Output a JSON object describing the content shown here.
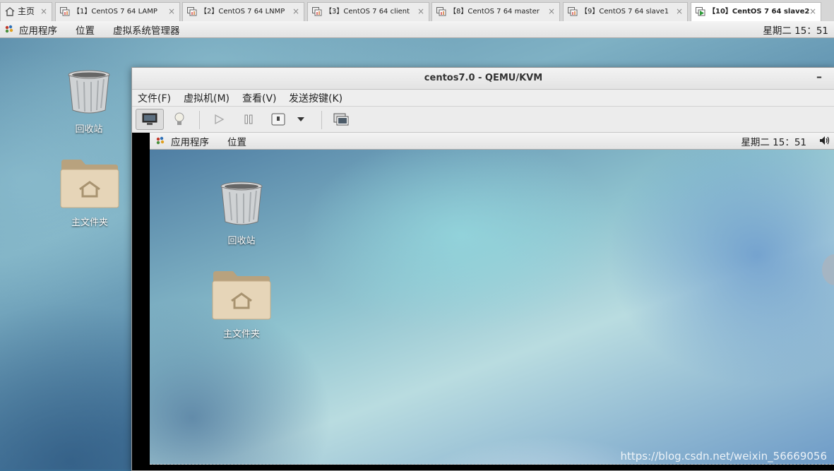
{
  "tabs": [
    {
      "label": "主页",
      "icon": "home-icon",
      "active": false
    },
    {
      "label": "【1】CentOS 7 64  LAMP",
      "icon": "vm-icon",
      "active": false
    },
    {
      "label": "【2】CentOS 7 64 LNMP",
      "icon": "vm-icon",
      "active": false
    },
    {
      "label": "【3】CentOS 7 64 client",
      "icon": "vm-icon",
      "active": false
    },
    {
      "label": "【8】CentOS 7 64 master",
      "icon": "vm-icon",
      "active": false
    },
    {
      "label": "【9】CentOS 7 64 slave1",
      "icon": "vm-icon",
      "active": false
    },
    {
      "label": "【10】CentOS 7 64 slave2",
      "icon": "vm-running-icon",
      "active": true
    }
  ],
  "tab_close_glyph": "×",
  "host_panel": {
    "menus": [
      "应用程序",
      "位置",
      "虚拟系统管理器"
    ],
    "clock": "星期二 15：51"
  },
  "host_desktop": {
    "icons": [
      {
        "label": "回收站",
        "icon": "trash-icon"
      },
      {
        "label": "主文件夹",
        "icon": "home-folder-icon"
      }
    ]
  },
  "vm_window": {
    "title": "centos7.0 - QEMU/KVM",
    "minimize_glyph": "–",
    "menu": [
      "文件(F)",
      "虚拟机(M)",
      "查看(V)",
      "发送按键(K)"
    ],
    "toolbar": [
      "console-icon",
      "lightbulb-icon",
      "play-icon",
      "pause-icon",
      "power-icon",
      "dropdown-arrow-icon",
      "screenshot-icon"
    ]
  },
  "guest": {
    "menus": [
      "应用程序",
      "位置"
    ],
    "clock": "星期二 15：51",
    "icons": [
      {
        "label": "回收站",
        "icon": "trash-icon"
      },
      {
        "label": "主文件夹",
        "icon": "home-folder-icon"
      }
    ]
  },
  "watermark": "https://blog.csdn.net/weixin_56669056",
  "colors": {
    "accent_green": "#2e9a3a",
    "desktop_blue": "#3b6f96"
  }
}
